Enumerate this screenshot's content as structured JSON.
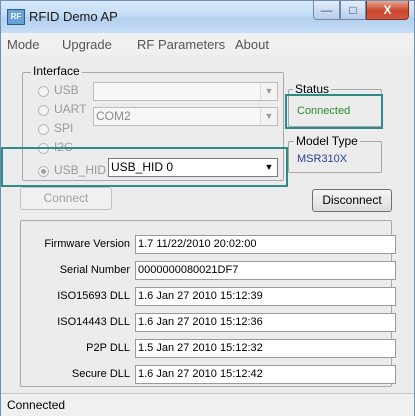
{
  "window": {
    "title": "RFID Demo AP",
    "app_icon": "rfid-app-icon",
    "app_icon_text": "RF"
  },
  "title_buttons": {
    "minimize": "—",
    "maximize": "□",
    "close": "X"
  },
  "menu": [
    "Mode",
    "Upgrade",
    "RF Parameters",
    "About"
  ],
  "interface": {
    "label": "Interface",
    "options": [
      {
        "label": "USB",
        "checked": false
      },
      {
        "label": "UART",
        "checked": false
      },
      {
        "label": "SPI",
        "checked": false
      },
      {
        "label": "I2C",
        "checked": false
      },
      {
        "label": "USB_HID",
        "checked": true
      }
    ],
    "usb_combo_value": "",
    "uart_combo_value": "COM2",
    "usb_hid_combo_value": "USB_HID 0",
    "dropdown_icon": "▼"
  },
  "status": {
    "label": "Status",
    "value": "Connected",
    "color": "#2a8a2a"
  },
  "model": {
    "label": "Model Type",
    "value": "MSR310X",
    "color": "#2b3f8f"
  },
  "buttons": {
    "connect": "Connect",
    "disconnect": "Disconnect"
  },
  "info": [
    {
      "label": "Firmware Version",
      "value": "1.7 11/22/2010 20:02:00"
    },
    {
      "label": "Serial Number",
      "value": "0000000080021DF7"
    },
    {
      "label": "ISO15693 DLL",
      "value": "1.6  Jan 27 2010 15:12:39"
    },
    {
      "label": "ISO14443 DLL",
      "value": "1.6  Jan 27 2010 15:12:36"
    },
    {
      "label": "P2P DLL",
      "value": "1.5  Jan 27 2010 15:12:32"
    },
    {
      "label": "Secure DLL",
      "value": "1.6  Jan 27 2010 15:12:42"
    }
  ],
  "statusbar": {
    "text": "Connected"
  },
  "accent_color": "#2f8a8a"
}
